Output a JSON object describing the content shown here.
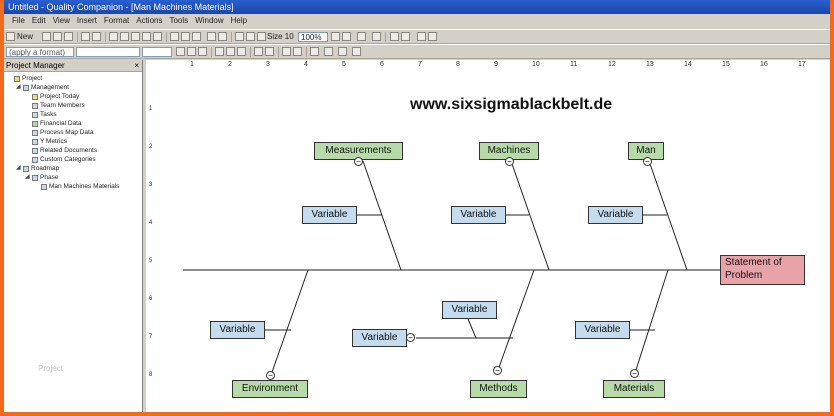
{
  "window": {
    "title": "Untitled - Quality Companion - [Man Machines Materials]",
    "menu": [
      "File",
      "Edit",
      "View",
      "Insert",
      "Format",
      "Actions",
      "Tools",
      "Window",
      "Help"
    ]
  },
  "toolbar": {
    "new_label": "New",
    "font_size": "Size 10",
    "zoom": "100%"
  },
  "format_bar": {
    "apply_format_placeholder": "(apply a format)"
  },
  "project_manager": {
    "title": "Project Manager",
    "close": "×",
    "tree": [
      {
        "label": "Project",
        "indent": 0,
        "expander": "",
        "icon": "y"
      },
      {
        "label": "Management",
        "indent": 1,
        "expander": "◢",
        "icon": "b"
      },
      {
        "label": "Project Today",
        "indent": 2,
        "expander": "",
        "icon": "y"
      },
      {
        "label": "Team Members",
        "indent": 2,
        "expander": "",
        "icon": "b"
      },
      {
        "label": "Tasks",
        "indent": 2,
        "expander": "",
        "icon": "b"
      },
      {
        "label": "Financial Data",
        "indent": 2,
        "expander": "",
        "icon": "g"
      },
      {
        "label": "Process Map Data",
        "indent": 2,
        "expander": "",
        "icon": "b"
      },
      {
        "label": "Y Metrics",
        "indent": 2,
        "expander": "",
        "icon": "b"
      },
      {
        "label": "Related Documents",
        "indent": 2,
        "expander": "",
        "icon": "b"
      },
      {
        "label": "Custom Categories",
        "indent": 2,
        "expander": "",
        "icon": "b"
      },
      {
        "label": "Roadmap",
        "indent": 1,
        "expander": "◢",
        "icon": "b"
      },
      {
        "label": "Phase",
        "indent": 2,
        "expander": "◢",
        "icon": "b"
      },
      {
        "label": "Man Machines Materials",
        "indent": 3,
        "expander": "",
        "icon": "b"
      }
    ]
  },
  "ruler": {
    "top": [
      "1",
      "2",
      "3",
      "4",
      "5",
      "6",
      "7",
      "8",
      "9",
      "10",
      "11",
      "12",
      "13",
      "14",
      "15",
      "16",
      "17"
    ],
    "left": [
      "1",
      "2",
      "3",
      "4",
      "5",
      "6",
      "7",
      "8"
    ]
  },
  "diagram": {
    "watermark_url": "www.sixsigmablackbelt.de",
    "statement": [
      "Statement of",
      "Problem"
    ],
    "categories": {
      "measurements": "Measurements",
      "machines": "Machines",
      "man": "Man",
      "environment": "Environment",
      "methods": "Methods",
      "materials": "Materials"
    },
    "variable_label": "Variable",
    "collapse_glyph": "−"
  },
  "ghost_text": "Project"
}
